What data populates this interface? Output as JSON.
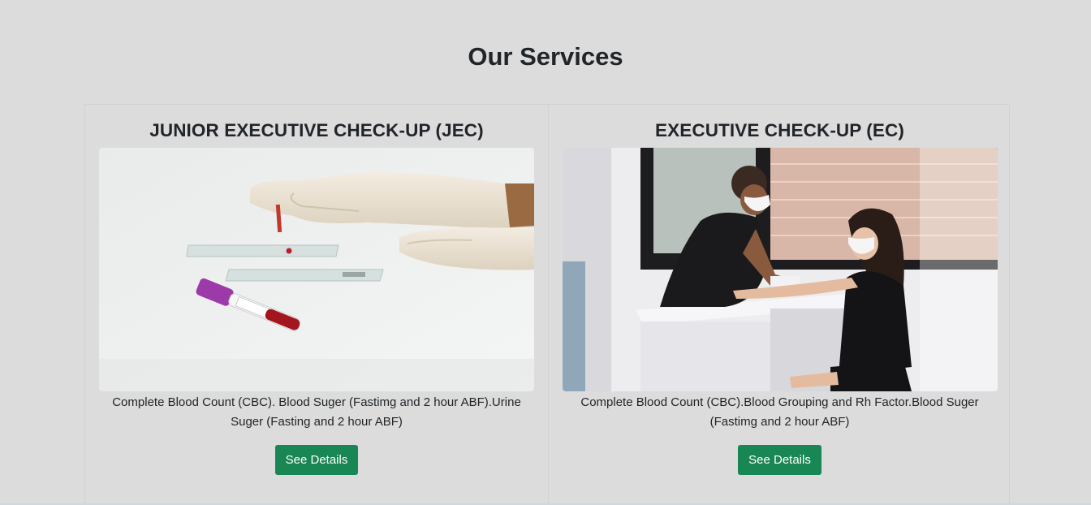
{
  "section": {
    "title": "Our Services"
  },
  "cards": [
    {
      "title": "JUNIOR EXECUTIVE CHECK-UP (JEC)",
      "image_alt": "Gloved hand holding blood sample pipette near glass slides and a blood test tube",
      "description": "Complete Blood Count (CBC). Blood Suger (Fastimg and 2 hour ABF).Urine Suger (Fasting and 2 hour ABF)",
      "button_label": "See Details"
    },
    {
      "title": "EXECUTIVE CHECK-UP (EC)",
      "image_alt": "Nurse wearing a mask drawing blood from a seated masked patient at a white desk",
      "description": "Complete Blood Count (CBC).Blood Grouping and Rh Factor.Blood Suger (Fastimg and 2 hour ABF)",
      "button_label": "See Details"
    }
  ],
  "colors": {
    "background": "#dcdcdc",
    "button": "#198754",
    "button_text": "#ffffff",
    "text": "#212529"
  }
}
